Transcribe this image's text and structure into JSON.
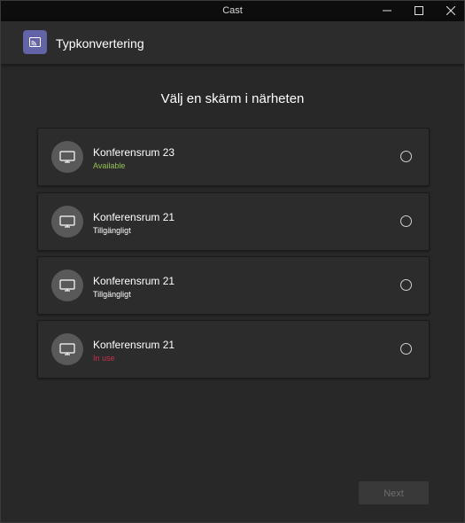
{
  "window": {
    "title": "Cast"
  },
  "header": {
    "app_title": "Typkonvertering"
  },
  "main": {
    "heading": "Välj en skärm i närheten",
    "devices": [
      {
        "name": "Konferensrum 23",
        "status": "Available",
        "status_color": "#92c353"
      },
      {
        "name": "Konferensrum 21",
        "status": "Tillgängligt",
        "status_color": "#ffffff"
      },
      {
        "name": "Konferensrum 21",
        "status": "Tillgängligt",
        "status_color": "#ffffff"
      },
      {
        "name": "Konferensrum 21",
        "status": "In use",
        "status_color": "#c4314b"
      }
    ]
  },
  "footer": {
    "next_label": "Next"
  },
  "icons": {
    "app": "cast-icon",
    "device": "monitor-icon"
  },
  "colors": {
    "accent": "#6264a7"
  }
}
